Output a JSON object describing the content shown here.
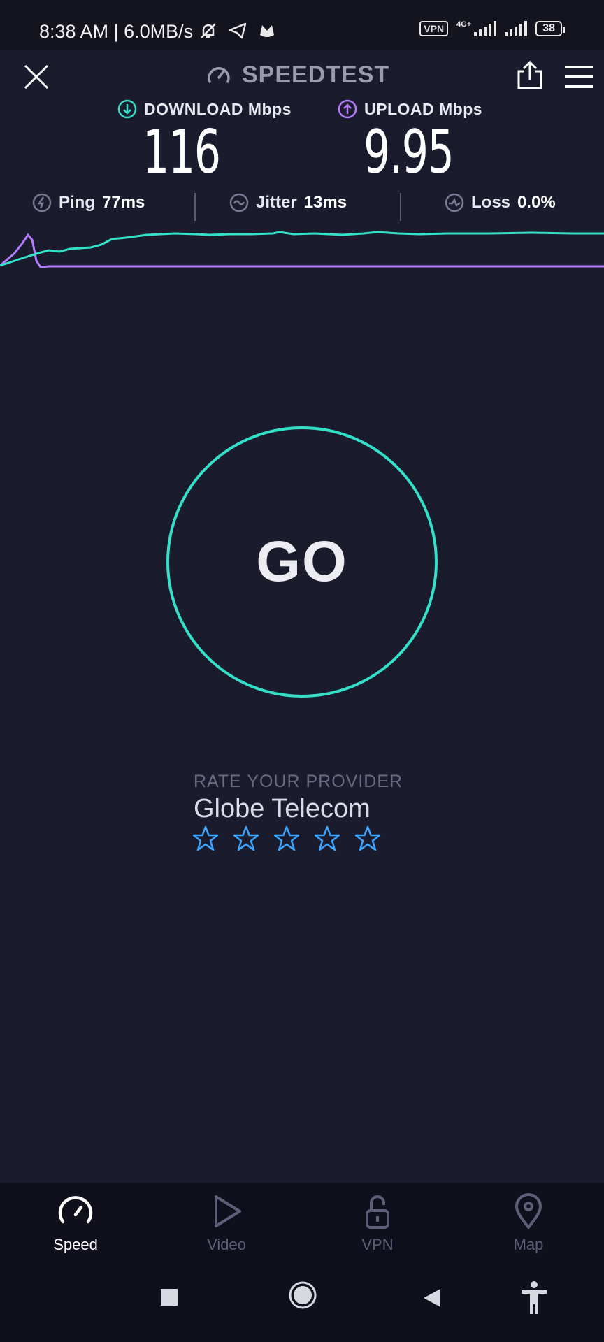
{
  "status_bar": {
    "time_speed": "8:38 AM | 6.0MB/s",
    "vpn_badge": "VPN",
    "network_type": "4G+",
    "battery": "38"
  },
  "header": {
    "title": "SPEEDTEST"
  },
  "download": {
    "label": "DOWNLOAD Mbps",
    "value": "116"
  },
  "upload": {
    "label": "UPLOAD Mbps",
    "value": "9.95"
  },
  "stats": {
    "ping_label": "Ping",
    "ping_value": "77ms",
    "jitter_label": "Jitter",
    "jitter_value": "13ms",
    "loss_label": "Loss",
    "loss_value": "0.0%"
  },
  "go_button": "GO",
  "rating": {
    "prompt": "RATE YOUR PROVIDER",
    "provider": "Globe Telecom",
    "star_count": 5
  },
  "bottom_nav": {
    "items": [
      {
        "label": "Speed",
        "icon": "speed-gauge-icon",
        "active": true
      },
      {
        "label": "Video",
        "icon": "play-icon",
        "active": false
      },
      {
        "label": "VPN",
        "icon": "lock-icon",
        "active": false
      },
      {
        "label": "Map",
        "icon": "map-pin-icon",
        "active": false
      }
    ]
  },
  "colors": {
    "accent_download": "#33e0c8",
    "accent_upload": "#b67cff",
    "background": "#1b1b2e",
    "star": "#3da4ff"
  }
}
